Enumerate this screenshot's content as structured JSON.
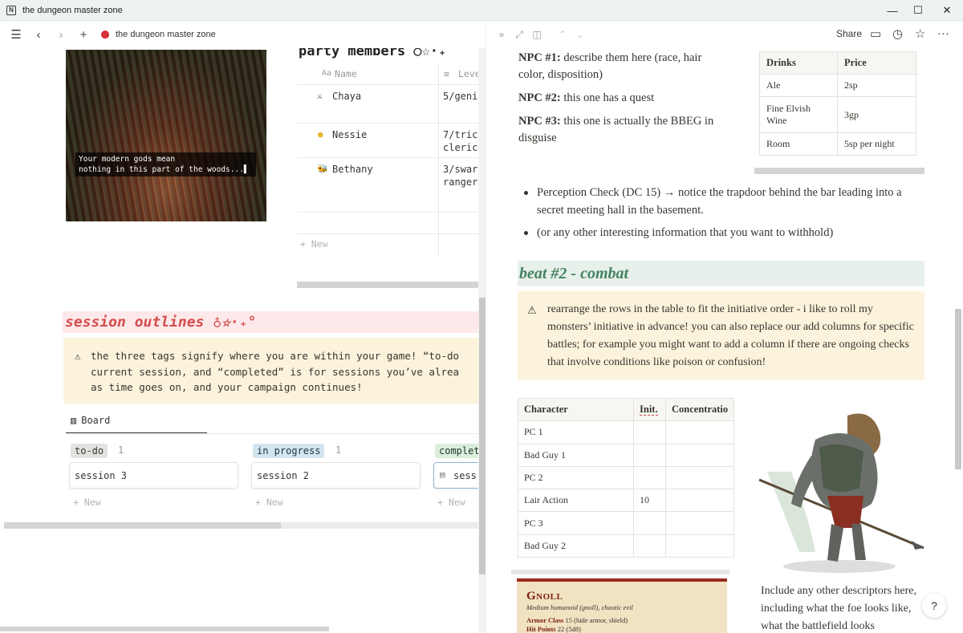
{
  "window": {
    "title": "the dungeon master zone",
    "icon": "notion-icon",
    "controls": {
      "minimize": "—",
      "maximize": "☐",
      "close": "✕"
    }
  },
  "left": {
    "breadcrumb": "the dungeon master zone",
    "cover_caption_line1": "Your modern gods mean",
    "cover_caption_line2": "nothing in this part of the woods...▌",
    "party": {
      "title": "party members ○☆·₊",
      "col_name": "Name",
      "col_name_icon": "Aa",
      "col_level": "Leve",
      "members": [
        {
          "emoji": "⚔",
          "name": "Chaya",
          "level_line1": "5/geni",
          "level_line2": ""
        },
        {
          "emoji": "●",
          "name": "Nessie",
          "level_line1": "7/tric",
          "level_line2": "cleric"
        },
        {
          "emoji": "🐝",
          "name": "Bethany",
          "level_line1": "3/swar",
          "level_line2": "ranger"
        }
      ],
      "new_label": "+ New"
    },
    "sessions": {
      "title": "session outlines ♁☆·₊°",
      "callout_line1": "the three tags signify where you are within your game! “to-do",
      "callout_line2": "current session, and “completed” is for sessions you’ve alrea",
      "callout_line3": "as time goes on, and your campaign continues!",
      "board_label": "Board",
      "groups": [
        {
          "tag": "to-do",
          "count": "1",
          "card": "session 3",
          "tag_bg": "#e3e2e0",
          "tag_fg": "#37352f"
        },
        {
          "tag": "in progress",
          "count": "1",
          "card": "session 2",
          "tag_bg": "#d3e5ef",
          "tag_fg": "#183347"
        },
        {
          "tag": "complet",
          "count": "",
          "card": "sess",
          "tag_bg": "#dbeddb",
          "tag_fg": "#1c3829"
        }
      ],
      "new_label": "+ New"
    }
  },
  "right": {
    "share": "Share",
    "npcs": [
      {
        "label": "NPC #1:",
        "text": " describe them here (race, hair color, disposition)"
      },
      {
        "label": "NPC #2:",
        "text": " this one has a quest"
      },
      {
        "label": "NPC #3:",
        "text": " this one is actually the BBEG in disguise"
      }
    ],
    "drinks_table": {
      "headers": [
        "Drinks",
        "Price"
      ],
      "rows": [
        [
          "Ale",
          "2sp"
        ],
        [
          "Fine Elvish Wine",
          "3gp"
        ],
        [
          "Room",
          "5sp per night"
        ]
      ]
    },
    "bullets": [
      "Perception Check (DC 15) → notice the trapdoor behind the bar leading into a secret meeting hall in the basement.",
      "(or any other interesting information that you want to withhold)"
    ],
    "beat_heading": "beat #2 - combat",
    "callout": "rearrange the rows in the table to fit the initiative order - i like to roll my monsters’ initiative in advance! you can also replace our add columns for specific battles; for example you might want to add a column if there are ongoing checks that involve conditions like poison or confusion!",
    "initiative_table": {
      "headers": [
        "Character",
        "Init.",
        "Concentratio"
      ],
      "rows": [
        [
          "PC 1",
          "",
          ""
        ],
        [
          "Bad Guy 1",
          "",
          ""
        ],
        [
          "PC 2",
          "",
          ""
        ],
        [
          "Lair Action",
          "10",
          ""
        ],
        [
          "PC 3",
          "",
          ""
        ],
        [
          "Bad Guy 2",
          "",
          ""
        ]
      ]
    },
    "statblock": {
      "name": "Gnoll",
      "subtitle": "Medium humanoid (gnoll), chaotic evil",
      "armor_class_label": "Armor Class",
      "armor_class_value": "15 (hide armor, shield)",
      "hit_points_label": "Hit Points",
      "hit_points_value": "22 (5d8)"
    },
    "descriptor": "Include any other descriptors here, including what the foe looks like, what the battlefield looks",
    "help": "?"
  }
}
